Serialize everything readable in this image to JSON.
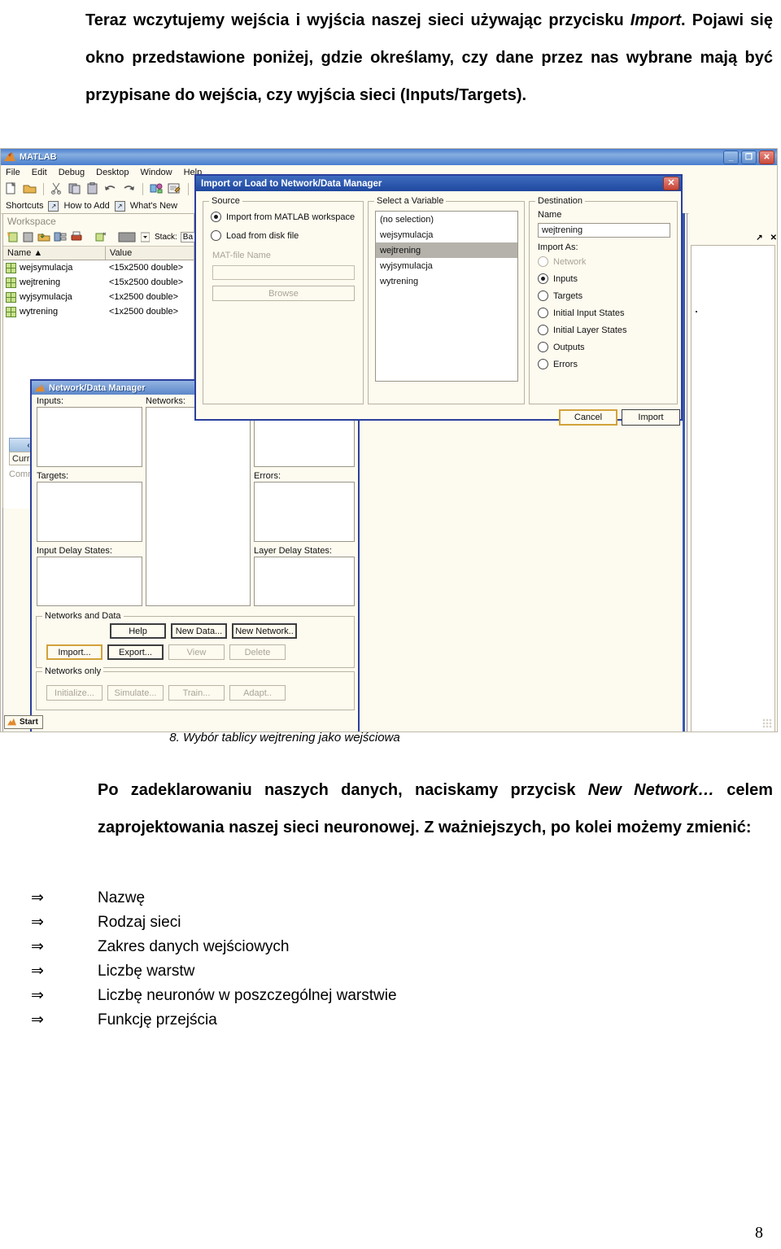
{
  "document": {
    "paragraph_top_html": "Teraz wczytujemy wejścia i wyjścia naszej sieci używając przycisku <i>Import</i>. Pojawi się okno przedstawione poniżej, gdzie określamy, czy dane przez nas wybrane mają być przypisane do wejścia, czy wyjścia sieci (Inputs/Targets).",
    "figure_caption": "8.    Wybór tablicy wejtrening jako wejściowa",
    "paragraph_mid_html": "Po zadeklarowaniu naszych danych, naciskamy przycisk <i>New Network…</i> celem zaprojektowania naszej sieci neuronowej. Z ważniejszych, po kolei możemy zmienić:",
    "bullet_marker": "⇒",
    "bullets": [
      "Nazwę",
      "Rodzaj sieci",
      "Zakres danych wejściowych",
      "Liczbę warstw",
      "Liczbę neuronów w poszczególnej warstwie",
      "Funkcję przejścia"
    ],
    "page_number": "8"
  },
  "matlab": {
    "title": "MATLAB",
    "menu": [
      "File",
      "Edit",
      "Debug",
      "Desktop",
      "Window",
      "Help"
    ],
    "window_buttons": {
      "minimize": "_",
      "maximize": "❐",
      "close": "✕"
    },
    "shortcuts_bar": {
      "label": "Shortcuts",
      "items": [
        "How to Add",
        "What's New"
      ]
    },
    "workspace": {
      "title": "Workspace",
      "stack_label": "Stack:",
      "stack_value": "Ba",
      "columns": [
        "Name  ▲",
        "Value"
      ],
      "rows": [
        {
          "name": "wejsymulacja",
          "value": "<15x2500 double>"
        },
        {
          "name": "wejtrening",
          "value": "<15x2500 double>"
        },
        {
          "name": "wyjsymulacja",
          "value": "<1x2500 double>"
        },
        {
          "name": "wytrening",
          "value": "<1x2500 double>"
        }
      ]
    },
    "residual": {
      "back_button": "‹",
      "current_tab": "Curre",
      "command_label": "Comm",
      "percent": "%",
      "expand": "⊟"
    },
    "start_button": "Start"
  },
  "ndm": {
    "title": "Network/Data Manager",
    "labels": {
      "inputs": "Inputs:",
      "networks": "Networks:",
      "targets": "Targets:",
      "errors": "Errors:",
      "input_delay_states": "Input Delay States:",
      "layer_delay_states": "Layer Delay States:"
    },
    "group_networks_and_data": "Networks and Data",
    "group_networks_only": "Networks only",
    "buttons_row1": [
      {
        "label": "Help",
        "state": "strong"
      },
      {
        "label": "New Data...",
        "state": "strong"
      },
      {
        "label": "New Network..",
        "state": "strong"
      }
    ],
    "buttons_row2": [
      {
        "label": "Import...",
        "state": "default"
      },
      {
        "label": "Export...",
        "state": "strong"
      },
      {
        "label": "View",
        "state": "disabled"
      },
      {
        "label": "Delete",
        "state": "disabled"
      }
    ],
    "buttons_row3": [
      {
        "label": "Initialize...",
        "state": "disabled"
      },
      {
        "label": "Simulate...",
        "state": "disabled"
      },
      {
        "label": "Train...",
        "state": "disabled"
      },
      {
        "label": "Adapt..",
        "state": "disabled"
      }
    ]
  },
  "dialog": {
    "title": "Import or Load to Network/Data Manager",
    "close_label": "✕",
    "source": {
      "legend": "Source",
      "option_workspace": "Import from MATLAB workspace",
      "option_diskfile": "Load from disk file",
      "selected": "workspace",
      "matfile_label": "MAT-file Name",
      "matfile_value": "",
      "browse_label": "Browse"
    },
    "select_variable": {
      "legend": "Select a Variable",
      "items": [
        "(no selection)",
        "wejsymulacja",
        "wejtrening",
        "wyjsymulacja",
        "wytrening"
      ],
      "selected_index": 2
    },
    "destination": {
      "legend": "Destination",
      "name_label": "Name",
      "name_value": "wejtrening",
      "import_as_label": "Import As:",
      "options": [
        {
          "label": "Network",
          "disabled": true
        },
        {
          "label": "Inputs",
          "disabled": false
        },
        {
          "label": "Targets",
          "disabled": false
        },
        {
          "label": "Initial Input States",
          "disabled": false
        },
        {
          "label": "Initial Layer States",
          "disabled": false
        },
        {
          "label": "Outputs",
          "disabled": false
        },
        {
          "label": "Errors",
          "disabled": false
        }
      ],
      "selected_index": 1
    },
    "cancel_label": "Cancel",
    "import_label": "Import"
  },
  "colors": {
    "title_blue": "#2a3f9c",
    "panel_bg": "#fdfaef",
    "selection_gray": "#b5b2ab",
    "accent_orange": "#d2a23a"
  }
}
